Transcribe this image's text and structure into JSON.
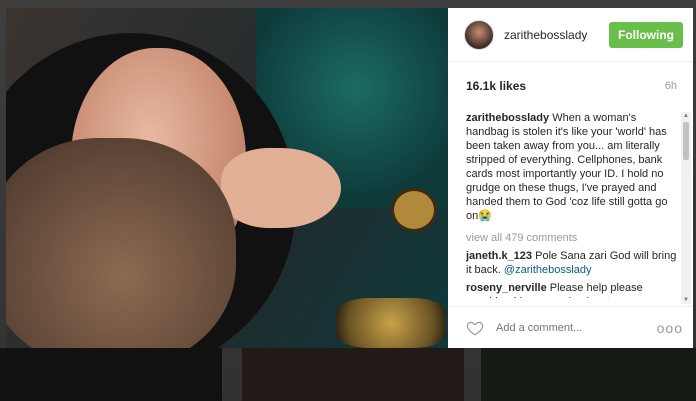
{
  "post": {
    "username": "zarithebosslady",
    "follow_label": "Following",
    "likes": "16.1k likes",
    "age": "6h"
  },
  "caption": {
    "author": "zarithebosslady",
    "text": "When a woman's handbag is stolen it's like your 'world' has been taken away from you... am literally stripped of everything. Cellphones, bank cards most importantly your ID. I hold no grudge on these thugs, I've prayed and handed them to God 'coz life still gotta go on😭"
  },
  "view_all": "view all 479 comments",
  "comments": [
    {
      "author": "janeth.k_123",
      "text": "Pole Sana zari God will bring it back.",
      "mention": "@zarithebosslady"
    },
    {
      "author": "roseny_nerville",
      "text": "Please help please consider this cause check out",
      "mention": ""
    }
  ],
  "footer": {
    "placeholder": "Add a comment...",
    "more_label": "ooo"
  },
  "icons": {
    "like": "heart-outline-icon",
    "more": "ellipsis-icon"
  },
  "colors": {
    "follow_button": "#6abf4b",
    "mention": "#125688"
  }
}
